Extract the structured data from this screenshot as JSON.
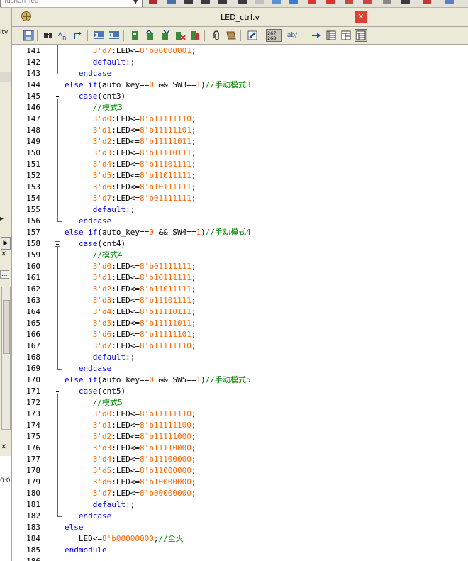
{
  "top_bar": {
    "project_partial": "iidshan_led"
  },
  "left_panel": {
    "label_ity": "ity",
    "label_time": "0:0",
    "label_dots": "..."
  },
  "editor": {
    "file_title": "LED_ctrl.v",
    "close_symbol": "✕",
    "toolbar_numbers": "267\n268",
    "toolbar_ab": "ab/"
  },
  "code_lines": [
    {
      "n": "141",
      "segs": [
        {
          "t": "      "
        },
        {
          "t": "3'd7",
          "c": "num"
        },
        {
          "t": ":LED<="
        },
        {
          "t": "8'b00000001",
          "c": "num"
        },
        {
          "t": ";"
        }
      ]
    },
    {
      "n": "142",
      "segs": [
        {
          "t": "      "
        },
        {
          "t": "default",
          "c": "kw"
        },
        {
          "t": ":;"
        }
      ]
    },
    {
      "n": "143",
      "segs": [
        {
          "t": "   "
        },
        {
          "t": "endcase",
          "c": "kw"
        }
      ]
    },
    {
      "n": "144",
      "segs": [
        {
          "t": "else if",
          "c": "kw"
        },
        {
          "t": "(auto_key=="
        },
        {
          "t": "0",
          "c": "num"
        },
        {
          "t": " && SW3=="
        },
        {
          "t": "1",
          "c": "num"
        },
        {
          "t": ")"
        },
        {
          "t": "//手动模式3",
          "c": "cm"
        }
      ]
    },
    {
      "n": "145",
      "segs": [
        {
          "t": "   "
        },
        {
          "t": "case",
          "c": "kw"
        },
        {
          "t": "(cnt3)"
        }
      ]
    },
    {
      "n": "146",
      "segs": [
        {
          "t": "      "
        },
        {
          "t": "//模式3",
          "c": "cm"
        }
      ]
    },
    {
      "n": "147",
      "segs": [
        {
          "t": "      "
        },
        {
          "t": "3'd0",
          "c": "num"
        },
        {
          "t": ":LED<="
        },
        {
          "t": "8'b11111110",
          "c": "num"
        },
        {
          "t": ";"
        }
      ]
    },
    {
      "n": "148",
      "segs": [
        {
          "t": "      "
        },
        {
          "t": "3'd1",
          "c": "num"
        },
        {
          "t": ":LED<="
        },
        {
          "t": "8'b11111101",
          "c": "num"
        },
        {
          "t": ";"
        }
      ]
    },
    {
      "n": "149",
      "segs": [
        {
          "t": "      "
        },
        {
          "t": "3'd2",
          "c": "num"
        },
        {
          "t": ":LED<="
        },
        {
          "t": "8'b11111011",
          "c": "num"
        },
        {
          "t": ";"
        }
      ]
    },
    {
      "n": "150",
      "segs": [
        {
          "t": "      "
        },
        {
          "t": "3'd3",
          "c": "num"
        },
        {
          "t": ":LED<="
        },
        {
          "t": "8'b11110111",
          "c": "num"
        },
        {
          "t": ";"
        }
      ]
    },
    {
      "n": "151",
      "segs": [
        {
          "t": "      "
        },
        {
          "t": "3'd4",
          "c": "num"
        },
        {
          "t": ":LED<="
        },
        {
          "t": "8'b11101111",
          "c": "num"
        },
        {
          "t": ";"
        }
      ]
    },
    {
      "n": "152",
      "segs": [
        {
          "t": "      "
        },
        {
          "t": "3'd5",
          "c": "num"
        },
        {
          "t": ":LED<="
        },
        {
          "t": "8'b11011111",
          "c": "num"
        },
        {
          "t": ";"
        }
      ]
    },
    {
      "n": "153",
      "segs": [
        {
          "t": "      "
        },
        {
          "t": "3'd6",
          "c": "num"
        },
        {
          "t": ":LED<="
        },
        {
          "t": "8'b10111111",
          "c": "num"
        },
        {
          "t": ";"
        }
      ]
    },
    {
      "n": "154",
      "segs": [
        {
          "t": "      "
        },
        {
          "t": "3'd7",
          "c": "num"
        },
        {
          "t": ":LED<="
        },
        {
          "t": "8'b01111111",
          "c": "num"
        },
        {
          "t": ";"
        }
      ]
    },
    {
      "n": "155",
      "segs": [
        {
          "t": "      "
        },
        {
          "t": "default",
          "c": "kw"
        },
        {
          "t": ":;"
        }
      ]
    },
    {
      "n": "156",
      "segs": [
        {
          "t": "   "
        },
        {
          "t": "endcase",
          "c": "kw"
        }
      ]
    },
    {
      "n": "157",
      "segs": [
        {
          "t": "else if",
          "c": "kw"
        },
        {
          "t": "(auto_key=="
        },
        {
          "t": "0",
          "c": "num"
        },
        {
          "t": " && SW4=="
        },
        {
          "t": "1",
          "c": "num"
        },
        {
          "t": ")"
        },
        {
          "t": "//手动模式4",
          "c": "cm"
        }
      ]
    },
    {
      "n": "158",
      "segs": [
        {
          "t": "   "
        },
        {
          "t": "case",
          "c": "kw"
        },
        {
          "t": "(cnt4)"
        }
      ]
    },
    {
      "n": "159",
      "segs": [
        {
          "t": "      "
        },
        {
          "t": "//模式4",
          "c": "cm"
        }
      ]
    },
    {
      "n": "160",
      "segs": [
        {
          "t": "      "
        },
        {
          "t": "3'd0",
          "c": "num"
        },
        {
          "t": ":LED<="
        },
        {
          "t": "8'b01111111",
          "c": "num"
        },
        {
          "t": ";"
        }
      ]
    },
    {
      "n": "161",
      "segs": [
        {
          "t": "      "
        },
        {
          "t": "3'd1",
          "c": "num"
        },
        {
          "t": ":LED<="
        },
        {
          "t": "8'b10111111",
          "c": "num"
        },
        {
          "t": ";"
        }
      ]
    },
    {
      "n": "162",
      "segs": [
        {
          "t": "      "
        },
        {
          "t": "3'd2",
          "c": "num"
        },
        {
          "t": ":LED<="
        },
        {
          "t": "8'b11011111",
          "c": "num"
        },
        {
          "t": ";"
        }
      ]
    },
    {
      "n": "163",
      "segs": [
        {
          "t": "      "
        },
        {
          "t": "3'd3",
          "c": "num"
        },
        {
          "t": ":LED<="
        },
        {
          "t": "8'b11101111",
          "c": "num"
        },
        {
          "t": ";"
        }
      ]
    },
    {
      "n": "164",
      "segs": [
        {
          "t": "      "
        },
        {
          "t": "3'd4",
          "c": "num"
        },
        {
          "t": ":LED<="
        },
        {
          "t": "8'b11110111",
          "c": "num"
        },
        {
          "t": ";"
        }
      ]
    },
    {
      "n": "165",
      "segs": [
        {
          "t": "      "
        },
        {
          "t": "3'd5",
          "c": "num"
        },
        {
          "t": ":LED<="
        },
        {
          "t": "8'b11111011",
          "c": "num"
        },
        {
          "t": ";"
        }
      ]
    },
    {
      "n": "166",
      "segs": [
        {
          "t": "      "
        },
        {
          "t": "3'd6",
          "c": "num"
        },
        {
          "t": ":LED<="
        },
        {
          "t": "8'b11111101",
          "c": "num"
        },
        {
          "t": ";"
        }
      ]
    },
    {
      "n": "167",
      "segs": [
        {
          "t": "      "
        },
        {
          "t": "3'd7",
          "c": "num"
        },
        {
          "t": ":LED<="
        },
        {
          "t": "8'b11111110",
          "c": "num"
        },
        {
          "t": ";"
        }
      ]
    },
    {
      "n": "168",
      "segs": [
        {
          "t": "      "
        },
        {
          "t": "default",
          "c": "kw"
        },
        {
          "t": ":;"
        }
      ]
    },
    {
      "n": "169",
      "segs": [
        {
          "t": "   "
        },
        {
          "t": "endcase",
          "c": "kw"
        }
      ]
    },
    {
      "n": "170",
      "segs": [
        {
          "t": "else if",
          "c": "kw"
        },
        {
          "t": "(auto_key=="
        },
        {
          "t": "0",
          "c": "num"
        },
        {
          "t": " && SW5=="
        },
        {
          "t": "1",
          "c": "num"
        },
        {
          "t": ")"
        },
        {
          "t": "//手动模式5",
          "c": "cm"
        }
      ]
    },
    {
      "n": "171",
      "segs": [
        {
          "t": "   "
        },
        {
          "t": "case",
          "c": "kw"
        },
        {
          "t": "(cnt5)"
        }
      ]
    },
    {
      "n": "172",
      "segs": [
        {
          "t": "      "
        },
        {
          "t": "//模式5",
          "c": "cm"
        }
      ]
    },
    {
      "n": "173",
      "segs": [
        {
          "t": "      "
        },
        {
          "t": "3'd0",
          "c": "num"
        },
        {
          "t": ":LED<="
        },
        {
          "t": "8'b11111110",
          "c": "num"
        },
        {
          "t": ";"
        }
      ]
    },
    {
      "n": "174",
      "segs": [
        {
          "t": "      "
        },
        {
          "t": "3'd1",
          "c": "num"
        },
        {
          "t": ":LED<="
        },
        {
          "t": "8'b11111100",
          "c": "num"
        },
        {
          "t": ";"
        }
      ]
    },
    {
      "n": "175",
      "segs": [
        {
          "t": "      "
        },
        {
          "t": "3'd2",
          "c": "num"
        },
        {
          "t": ":LED<="
        },
        {
          "t": "8'b11111000",
          "c": "num"
        },
        {
          "t": ";"
        }
      ]
    },
    {
      "n": "176",
      "segs": [
        {
          "t": "      "
        },
        {
          "t": "3'd3",
          "c": "num"
        },
        {
          "t": ":LED<="
        },
        {
          "t": "8'b11110000",
          "c": "num"
        },
        {
          "t": ";"
        }
      ]
    },
    {
      "n": "177",
      "segs": [
        {
          "t": "      "
        },
        {
          "t": "3'd4",
          "c": "num"
        },
        {
          "t": ":LED<="
        },
        {
          "t": "8'b11100000",
          "c": "num"
        },
        {
          "t": ";"
        }
      ]
    },
    {
      "n": "178",
      "segs": [
        {
          "t": "      "
        },
        {
          "t": "3'd5",
          "c": "num"
        },
        {
          "t": ":LED<="
        },
        {
          "t": "8'b11000000",
          "c": "num"
        },
        {
          "t": ";"
        }
      ]
    },
    {
      "n": "179",
      "segs": [
        {
          "t": "      "
        },
        {
          "t": "3'd6",
          "c": "num"
        },
        {
          "t": ":LED<="
        },
        {
          "t": "8'b10000000",
          "c": "num"
        },
        {
          "t": ";"
        }
      ]
    },
    {
      "n": "180",
      "segs": [
        {
          "t": "      "
        },
        {
          "t": "3'd7",
          "c": "num"
        },
        {
          "t": ":LED<="
        },
        {
          "t": "8'b00000000",
          "c": "num"
        },
        {
          "t": ";"
        }
      ]
    },
    {
      "n": "181",
      "segs": [
        {
          "t": "      "
        },
        {
          "t": "default",
          "c": "kw"
        },
        {
          "t": ":;"
        }
      ]
    },
    {
      "n": "182",
      "segs": [
        {
          "t": "   "
        },
        {
          "t": "endcase",
          "c": "kw"
        }
      ]
    },
    {
      "n": "183",
      "segs": [
        {
          "t": "else",
          "c": "kw"
        }
      ]
    },
    {
      "n": "184",
      "segs": [
        {
          "t": "   LED<="
        },
        {
          "t": "8'b00000000",
          "c": "num"
        },
        {
          "t": ";"
        },
        {
          "t": "//全灭",
          "c": "cm"
        }
      ]
    },
    {
      "n": "185",
      "segs": [
        {
          "t": "endmodule",
          "c": "kw"
        }
      ]
    },
    {
      "n": "186",
      "segs": []
    }
  ],
  "icons": {
    "app": "modelsim-file-icon",
    "close": "close-icon"
  }
}
